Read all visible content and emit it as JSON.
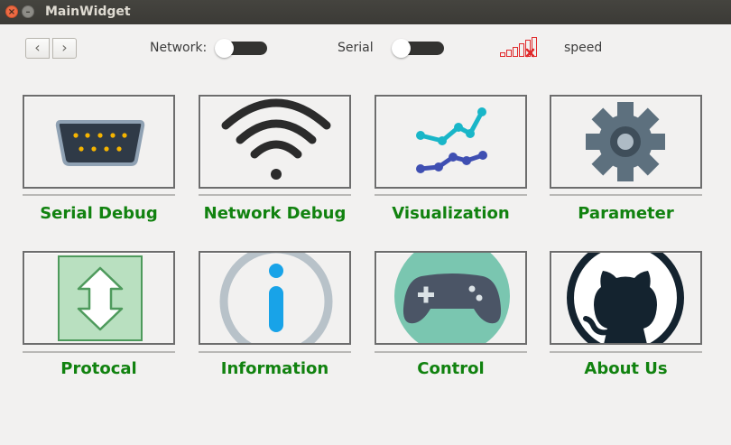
{
  "window": {
    "title": "MainWidget",
    "close_glyph": "×",
    "minimize_glyph": "–"
  },
  "toolbar": {
    "back_glyph": "‹",
    "forward_glyph": "›",
    "network_label": "Network:",
    "serial_label": "Serial",
    "speed_label": "speed",
    "network_switch_on": false,
    "serial_switch_on": false,
    "signal_icon": "signal-bars-disconnected-icon"
  },
  "tiles": [
    {
      "label": "Serial Debug",
      "icon": "serial-port-icon"
    },
    {
      "label": "Network Debug",
      "icon": "wifi-icon"
    },
    {
      "label": "Visualization",
      "icon": "line-chart-icon"
    },
    {
      "label": "Parameter",
      "icon": "gear-icon"
    },
    {
      "label": "Protocal",
      "icon": "up-down-arrow-icon"
    },
    {
      "label": "Information",
      "icon": "info-icon"
    },
    {
      "label": "Control",
      "icon": "gamepad-icon"
    },
    {
      "label": "About Us",
      "icon": "github-icon"
    }
  ],
  "colors": {
    "caption": "#11820f",
    "titlebar": "#3c3b37",
    "background": "#f2f1f0"
  }
}
